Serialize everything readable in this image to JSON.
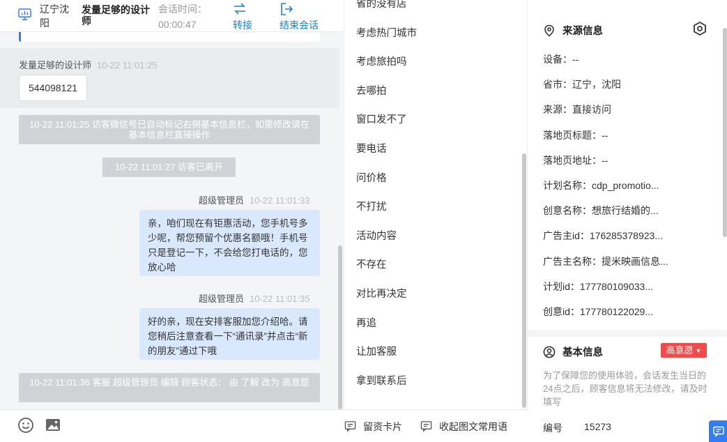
{
  "header": {
    "location": "辽宁沈阳",
    "visitor_name": "发量足够的设计师",
    "timer_label": "会话时间：",
    "timer_value": "00:00:47",
    "transfer_label": "转接",
    "end_label": "结束会话"
  },
  "messages": {
    "visitor_sender": "发量足够的设计师",
    "visitor_time": "10-22 11:01:25",
    "visitor_content": "544098121",
    "note1": "10-22 11:01:25 访客微信号已自动标记右侧基本信息栏，如需修改请在基本信息栏直接操作",
    "note2": "10-22 11:01:27 访客已离开",
    "agent1_sender": "超级管理员",
    "agent1_time": "10-22 11:01:33",
    "agent1_content": "亲，咱们现在有钜惠活动，您手机号多少呢，帮您预留个优惠名额哦！手机号只是登记一下，不会给您打电话的，您放心哈",
    "agent2_sender": "超级管理员",
    "agent2_time": "10-22 11:01:35",
    "agent2_content": "好的亲，现在安排客服加您介绍哈。请您稍后注意查看一下“通讯录”并点击“新的朋友”通过下哦",
    "note3": "10-22 11:01:36 客服 超级管理员 编辑 顾客状态： 由 了解 改为 高意愿"
  },
  "toolbar": {
    "emoji_icon": "smile-icon",
    "image_icon": "image-icon",
    "card_label": "留资卡片",
    "phrases_label": "收起图文常用语"
  },
  "phrases": {
    "items": [
      "省的没有店",
      "考虑热门城市",
      "考虑旅拍吗",
      "去哪拍",
      "窗口发不了",
      "要电话",
      "问价格",
      "不打扰",
      "活动内容",
      "不存在",
      "对比再决定",
      "再追",
      "让加客服",
      "拿到联系后"
    ]
  },
  "source_info": {
    "title": "来源信息",
    "rows": [
      "设备：--",
      "省市：辽宁，沈阳",
      "来源：直接访问",
      "落地页标题：--",
      "落地页地址：--",
      "计划名称：cdp_promotio...",
      "创意名称：想旅行结婚的...",
      "广告主id：176285378923...",
      "广告主名称：提米映画信息...",
      "计划id：177780109033...",
      "创意id：177780122029..."
    ]
  },
  "base_info": {
    "title": "基本信息",
    "intent": "高意愿",
    "note": "为了保障您的使用体验，会话发生当日的24点之后，顾客信息将无法修改，请及时填写",
    "id_label": "编号",
    "id_value": "15273"
  },
  "colors": {
    "accent": "#1e7fd6",
    "bubble": "#d9e8fc",
    "badge": "#f04b4b",
    "system_note": "#d1d2d5"
  }
}
